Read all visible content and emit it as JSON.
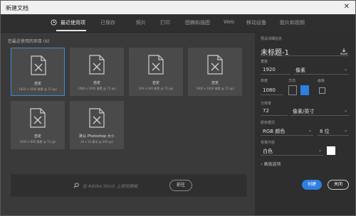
{
  "window": {
    "title": "新建文档",
    "close_glyph": "✕"
  },
  "tabs": [
    {
      "label": "最近使用项",
      "active": true
    },
    {
      "label": "已保存",
      "active": false
    },
    {
      "label": "照片",
      "active": false
    },
    {
      "label": "打印",
      "active": false
    },
    {
      "label": "图稿和插图",
      "active": false
    },
    {
      "label": "Web",
      "active": false
    },
    {
      "label": "移动设备",
      "active": false
    },
    {
      "label": "胶片和视频",
      "active": false
    }
  ],
  "recent": {
    "label": "您最近使用的项目 (6)",
    "items": [
      {
        "name": "自定",
        "meta": "1920 x 1080 像素 @ 72 ppi"
      },
      {
        "name": "自定",
        "meta": "1080 x 1920 像素 @ 72 ppi"
      },
      {
        "name": "自定",
        "meta": "244 x 440 像素 @ 72 ppi"
      },
      {
        "name": "自定",
        "meta": "1000 x 1000 像素 @ 72 ppi"
      },
      {
        "name": "自定",
        "meta": "1600 x 800 像素 @ 72 ppi"
      },
      {
        "name": "默认 Photoshop 大小",
        "meta": "16 x 12 厘米 @ 300 ppi"
      }
    ]
  },
  "search": {
    "placeholder": "在 Adobe Stock 上查找模板",
    "go_label": "前往"
  },
  "details": {
    "section_label": "预设详细信息",
    "doc_name": "未标题-1",
    "width_label": "宽度",
    "width_value": "1920",
    "width_unit": "像素",
    "height_label": "高度",
    "height_value": "1080",
    "orientation_label": "方向",
    "artboard_label": "画板",
    "resolution_label": "分辨率",
    "resolution_value": "72",
    "resolution_unit": "像素/英寸",
    "color_mode_label": "颜色模式",
    "color_mode_value": "RGB 颜色",
    "bit_depth_value": "8 位",
    "background_label": "背景内容",
    "background_value": "白色",
    "background_color": "#ffffff",
    "advanced_label": "高级选项"
  },
  "buttons": {
    "create": "创建",
    "close": "关闭"
  },
  "colors": {
    "accent": "#2d7fe0",
    "selected_border": "#3b8bd8"
  }
}
